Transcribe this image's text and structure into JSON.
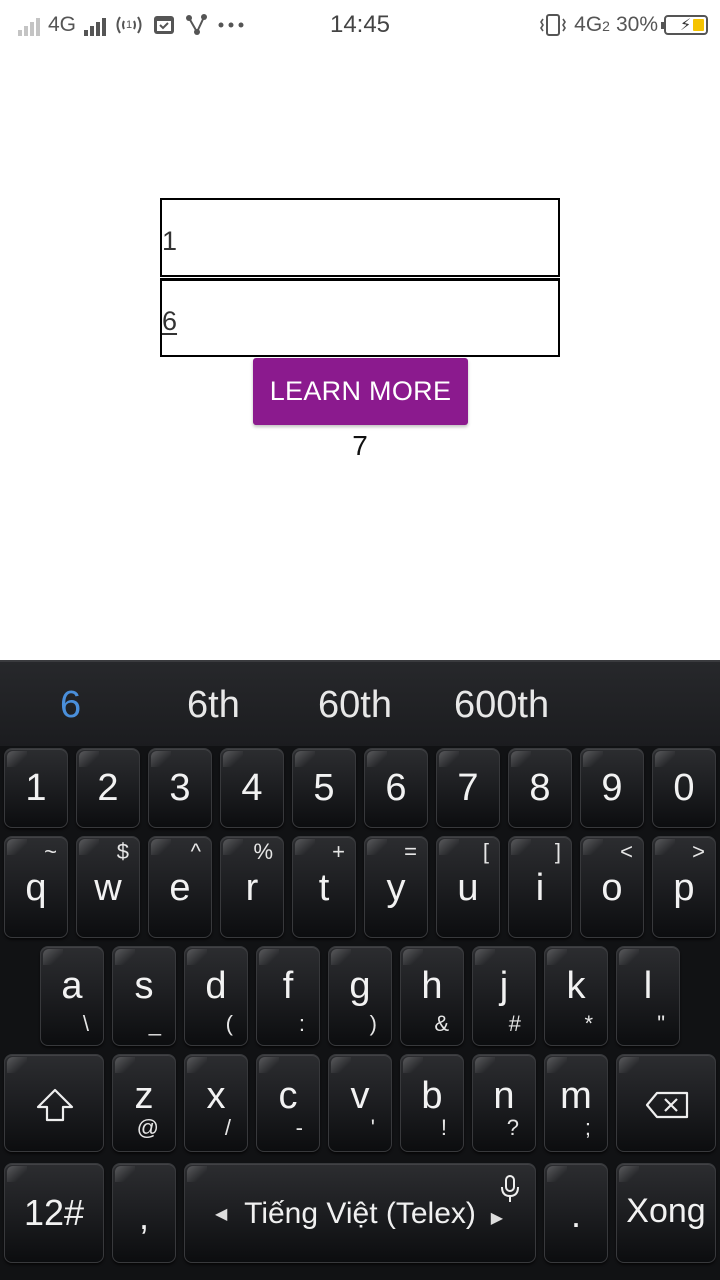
{
  "status_bar": {
    "network_left": "4G",
    "time": "14:45",
    "network_right": "4G",
    "sim_index": "2",
    "battery_percent": "30%",
    "battery_level": 0.3,
    "battery_color": "#f5c300"
  },
  "form": {
    "field1_value": "1",
    "field2_value": "6",
    "button_label": "LEARN MORE",
    "button_color": "#8b1a8e",
    "result": "7"
  },
  "keyboard": {
    "suggestions": [
      "6",
      "6th",
      "60th",
      "600th"
    ],
    "suggestion_highlight_color": "#4a8fdb",
    "numbers": [
      "1",
      "2",
      "3",
      "4",
      "5",
      "6",
      "7",
      "8",
      "9",
      "0"
    ],
    "row_q": [
      {
        "key": "q",
        "sub": "~"
      },
      {
        "key": "w",
        "sub": "$"
      },
      {
        "key": "e",
        "sub": "^"
      },
      {
        "key": "r",
        "sub": "%"
      },
      {
        "key": "t",
        "sub": "+"
      },
      {
        "key": "y",
        "sub": "="
      },
      {
        "key": "u",
        "sub": "["
      },
      {
        "key": "i",
        "sub": "]"
      },
      {
        "key": "o",
        "sub": "<"
      },
      {
        "key": "p",
        "sub": ">"
      }
    ],
    "row_a": [
      {
        "key": "a",
        "sub": "\\"
      },
      {
        "key": "s",
        "sub": "_"
      },
      {
        "key": "d",
        "sub": "("
      },
      {
        "key": "f",
        "sub": ":"
      },
      {
        "key": "g",
        "sub": ")"
      },
      {
        "key": "h",
        "sub": "&"
      },
      {
        "key": "j",
        "sub": "#"
      },
      {
        "key": "k",
        "sub": "*"
      },
      {
        "key": "l",
        "sub": "\""
      }
    ],
    "row_z": [
      {
        "key": "z",
        "sub": "@"
      },
      {
        "key": "x",
        "sub": "/"
      },
      {
        "key": "c",
        "sub": "-"
      },
      {
        "key": "v",
        "sub": "'"
      },
      {
        "key": "b",
        "sub": "!"
      },
      {
        "key": "n",
        "sub": "?"
      },
      {
        "key": "m",
        "sub": ";"
      }
    ],
    "symbols_key": "12#",
    "comma_key": ",",
    "space_label": "Tiếng Việt (Telex)",
    "period_key": ".",
    "done_key": "Xong"
  }
}
